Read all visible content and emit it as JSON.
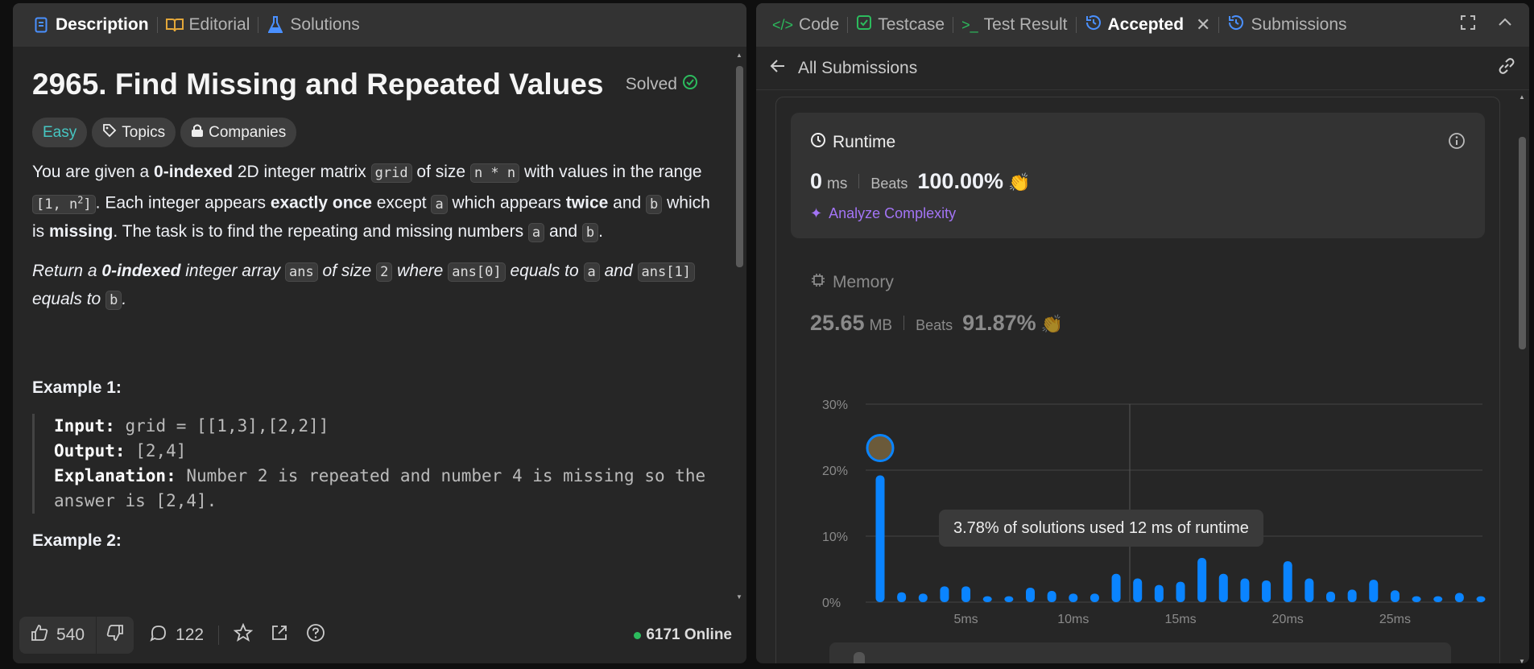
{
  "left_tabs": [
    {
      "label": "Description",
      "icon": "description-icon",
      "color": "#4a90ff"
    },
    {
      "label": "Editorial",
      "icon": "book-icon",
      "color": "#e3a73a"
    },
    {
      "label": "Solutions",
      "icon": "flask-icon",
      "color": "#4a90ff"
    }
  ],
  "problem": {
    "title": "2965. Find Missing and Repeated Values",
    "status": "Solved",
    "difficulty": "Easy",
    "topics_label": "Topics",
    "companies_label": "Companies",
    "desc": {
      "p1": [
        "You are given a ",
        "0-indexed",
        " 2D integer matrix ",
        "grid",
        " of size ",
        "n * n",
        " with values in the range ",
        "[1, n",
        "2",
        "]",
        ". Each integer appears ",
        "exactly once",
        " except ",
        "a",
        " which appears ",
        "twice",
        " and ",
        "b",
        " which is ",
        "missing",
        ". The task is to find the repeating and missing numbers ",
        "a",
        " and ",
        "b",
        "."
      ],
      "p2": [
        "Return ",
        "a ",
        "0-indexed",
        " integer array ",
        "ans",
        " of size ",
        "2",
        " where ",
        "ans[0]",
        " equals to ",
        "a",
        " and ",
        "ans[1]",
        " equals to ",
        "b",
        "."
      ]
    },
    "example1": {
      "heading": "Example 1:",
      "input_label": "Input:",
      "input": "grid = [[1,3],[2,2]]",
      "output_label": "Output:",
      "output": "[2,4]",
      "explanation_label": "Explanation:",
      "explanation": "Number 2 is repeated and number 4 is missing so the answer is [2,4]."
    },
    "example2_heading": "Example 2:"
  },
  "footer": {
    "likes": "540",
    "comments": "122",
    "online": "6171 Online",
    "online_color": "#2cbb5d"
  },
  "right_tabs": [
    {
      "label": "Code",
      "icon": "code-icon",
      "color": "#2cbb5d"
    },
    {
      "label": "Testcase",
      "icon": "checkbox-icon",
      "color": "#2cbb5d"
    },
    {
      "label": "Test Result",
      "icon": "terminal-icon",
      "color": "#2cbb5d"
    },
    {
      "label": "Accepted",
      "icon": "history-icon",
      "color": "#4a90ff"
    },
    {
      "label": "Submissions",
      "icon": "history-icon",
      "color": "#4a90ff"
    }
  ],
  "submissions": {
    "back_label": "All Submissions",
    "runtime": {
      "label": "Runtime",
      "value": "0",
      "unit": "ms",
      "beats_label": "Beats",
      "beats": "100.00%",
      "analyze_label": "Analyze Complexity"
    },
    "memory": {
      "label": "Memory",
      "value": "25.65",
      "unit": "MB",
      "beats_label": "Beats",
      "beats": "91.87%"
    },
    "tooltip": "3.78% of solutions used 12 ms of runtime"
  },
  "chart_data": {
    "type": "bar",
    "y_ticks": [
      "30%",
      "20%",
      "10%",
      "0%"
    ],
    "x_ticks": [
      "5ms",
      "10ms",
      "15ms",
      "20ms",
      "25ms"
    ],
    "ylim": [
      0,
      30
    ],
    "bar_color": "#0a84ff",
    "values": [
      19.2,
      1.5,
      1.3,
      2.4,
      2.4,
      0.9,
      0.9,
      2.2,
      1.7,
      1.3,
      1.3,
      4.3,
      3.6,
      2.6,
      3.1,
      6.7,
      4.3,
      3.6,
      3.3,
      6.2,
      3.6,
      1.6,
      1.9,
      3.4,
      1.8,
      0.9,
      0.9,
      1.4,
      0.9
    ]
  }
}
